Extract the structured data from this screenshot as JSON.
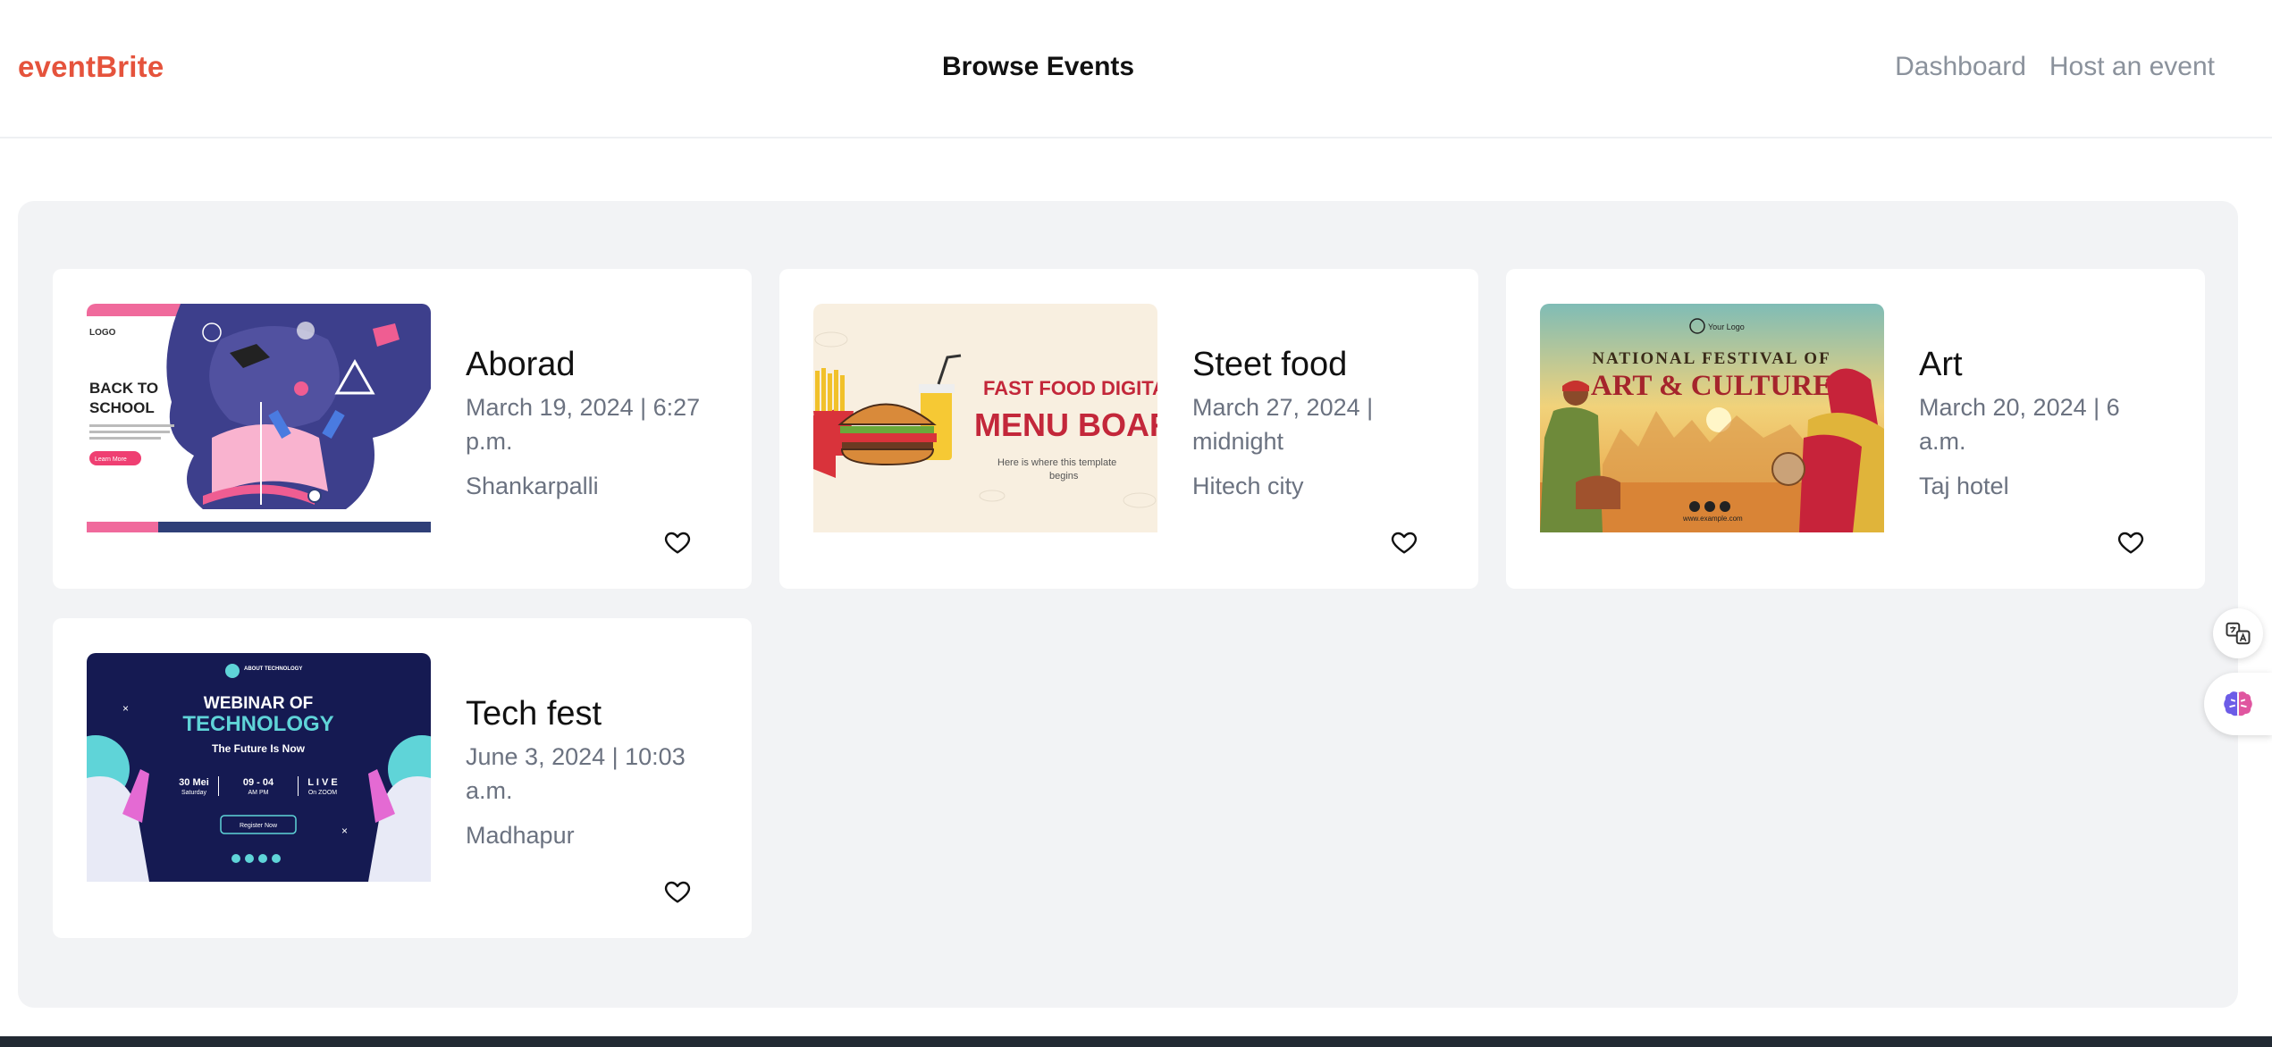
{
  "header": {
    "brand": "eventBrite",
    "title": "Browse Events",
    "nav": [
      "Dashboard",
      "Host an event"
    ]
  },
  "events": [
    {
      "title": "Aborad",
      "date": "March 19, 2024 | 6:27 p.m.",
      "location": "Shankarpalli",
      "image_text": {
        "logo": "LOGO",
        "line1": "BACK TO",
        "line2": "SCHOOL",
        "button": "Learn More"
      }
    },
    {
      "title": "Steet food",
      "date": "March 27, 2024 | midnight",
      "location": "Hitech city",
      "image_text": {
        "line1": "FAST FOOD DIGITAL",
        "line2": "MENU BOARD",
        "sub1": "Here is where this template",
        "sub2": "begins"
      }
    },
    {
      "title": "Art",
      "date": "March 20, 2024 | 6 a.m.",
      "location": "Taj hotel",
      "image_text": {
        "logo": "Your Logo",
        "line1": "NATIONAL FESTIVAL OF",
        "line2": "ART & CULTURE",
        "site": "www.example.com"
      }
    },
    {
      "title": "Tech fest",
      "date": "June 3, 2024 | 10:03 a.m.",
      "location": "Madhapur",
      "image_text": {
        "top": "ABOUT TECHNOLOGY",
        "line1": "WEBINAR OF",
        "line2": "TECHNOLOGY",
        "tagline": "The Future Is Now",
        "d1": "30 Mei",
        "d1b": "Saturday",
        "d2": "09 - 04",
        "d2b": "AM    PM",
        "d3": "L I V E",
        "d3b": "On ZOOM",
        "button": "Register Now"
      }
    }
  ],
  "icons": {
    "favorite": "heart-outline-icon",
    "translate": "translate-icon",
    "assistant": "brain-icon"
  },
  "colors": {
    "brand": "#e5533c",
    "panel": "#f2f3f5",
    "muted_text": "#6b7280"
  }
}
